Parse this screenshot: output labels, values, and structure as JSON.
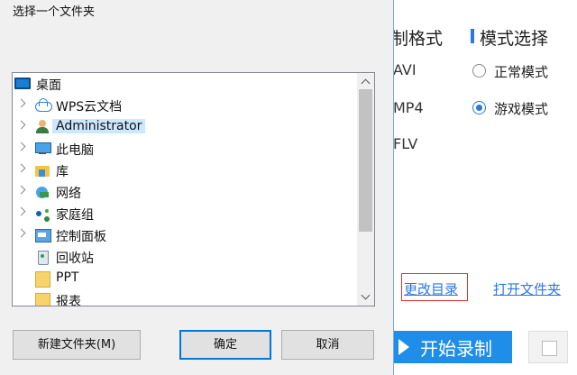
{
  "dialog": {
    "title": "选择一个文件夹",
    "tree": [
      {
        "label": "桌面",
        "icon": "desktop-icon"
      },
      {
        "label": "WPS云文档",
        "icon": "cloud-icon"
      },
      {
        "label": "Administrator",
        "icon": "user-icon",
        "selected": true
      },
      {
        "label": "此电脑",
        "icon": "computer-icon"
      },
      {
        "label": "库",
        "icon": "library-icon"
      },
      {
        "label": "网络",
        "icon": "network-icon"
      },
      {
        "label": "家庭组",
        "icon": "homegroup-icon"
      },
      {
        "label": "控制面板",
        "icon": "control-panel-icon"
      },
      {
        "label": "回收站",
        "icon": "recycle-bin-icon"
      },
      {
        "label": "PPT",
        "icon": "folder-icon"
      },
      {
        "label": "报表",
        "icon": "folder-icon"
      }
    ],
    "buttons": {
      "new_folder": "新建文件夹(M)",
      "ok": "确定",
      "cancel": "取消"
    }
  },
  "app": {
    "format_header": "制格式",
    "mode_header": "模式选择",
    "formats": [
      "AVI",
      "MP4",
      "FLV"
    ],
    "modes": {
      "normal": "正常模式",
      "game": "游戏模式",
      "selected": "game"
    },
    "change_dir": "更改目录",
    "open_folder": "打开文件夹",
    "start_record": "开始录制",
    "accent_color": "#2b78e4",
    "button_color": "#1e8ee8",
    "highlight_color": "#e03030"
  }
}
